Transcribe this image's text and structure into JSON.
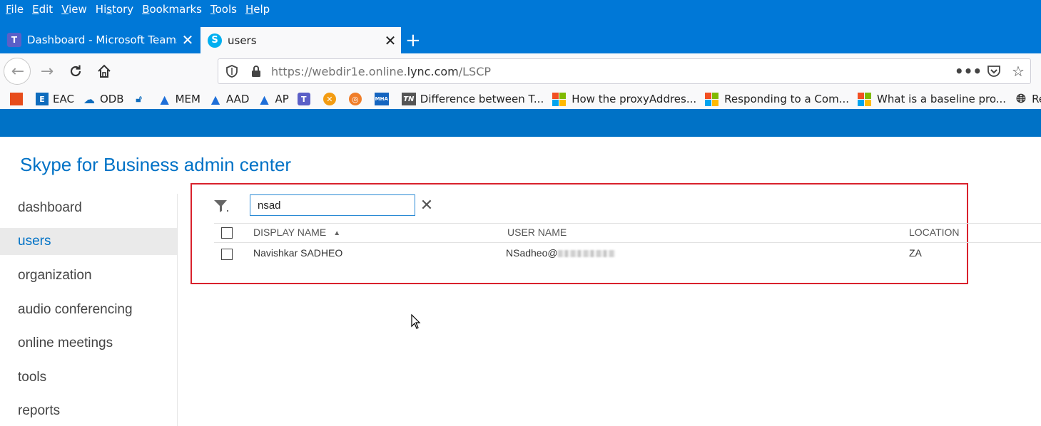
{
  "browser": {
    "menu": [
      "File",
      "Edit",
      "View",
      "History",
      "Bookmarks",
      "Tools",
      "Help"
    ],
    "menu_access_keys": [
      "F",
      "E",
      "V",
      "s",
      "B",
      "T",
      "H"
    ],
    "tabs": [
      {
        "title": "Dashboard - Microsoft Teams a",
        "favicon": "teams-icon",
        "active": false
      },
      {
        "title": "users",
        "favicon": "skype-icon",
        "active": true
      }
    ],
    "url_host": "https://webdir1e.online.",
    "url_domain": "lync.com",
    "url_path": "/LSCP",
    "bookmarks": [
      {
        "label": "",
        "icon": "office-icon"
      },
      {
        "label": "EAC",
        "icon": "exchange-icon"
      },
      {
        "label": "ODB",
        "icon": "onedrive-icon"
      },
      {
        "label": "",
        "icon": "lock-icon"
      },
      {
        "label": "MEM",
        "icon": "azure-icon"
      },
      {
        "label": "AAD",
        "icon": "azure-icon"
      },
      {
        "label": "AP",
        "icon": "azure-icon"
      },
      {
        "label": "",
        "icon": "teams-icon"
      },
      {
        "label": "",
        "icon": "orange-x-icon"
      },
      {
        "label": "",
        "icon": "orange-circle-icon"
      },
      {
        "label": "",
        "icon": "mha-icon"
      },
      {
        "label": "Difference between T...",
        "icon": "tn-icon"
      },
      {
        "label": "How the proxyAddres...",
        "icon": "microsoft-logo-icon"
      },
      {
        "label": "Responding to a Com...",
        "icon": "microsoft-logo-icon"
      },
      {
        "label": "What is a baseline pro...",
        "icon": "microsoft-logo-icon"
      },
      {
        "label": "Restricting",
        "icon": "globe-icon"
      }
    ],
    "bookmark_icon_text": {
      "tn": "TN",
      "mha": "MHA",
      "teams": "T"
    }
  },
  "app": {
    "title": "Skype for Business admin center",
    "accent": "#0072c6",
    "nav": [
      {
        "label": "dashboard",
        "selected": false
      },
      {
        "label": "users",
        "selected": true
      },
      {
        "label": "organization",
        "selected": false
      },
      {
        "label": "audio conferencing",
        "selected": false
      },
      {
        "label": "online meetings",
        "selected": false
      },
      {
        "label": "tools",
        "selected": false
      },
      {
        "label": "reports",
        "selected": false
      }
    ]
  },
  "users": {
    "search_value": "nsad",
    "columns": [
      "DISPLAY NAME",
      "USER NAME",
      "LOCATION"
    ],
    "sort_column": "DISPLAY NAME",
    "sort_direction": "ascending",
    "rows": [
      {
        "display_name": "Navishkar SADHEO",
        "user_name": "NSadheo@",
        "location": "ZA"
      }
    ]
  }
}
